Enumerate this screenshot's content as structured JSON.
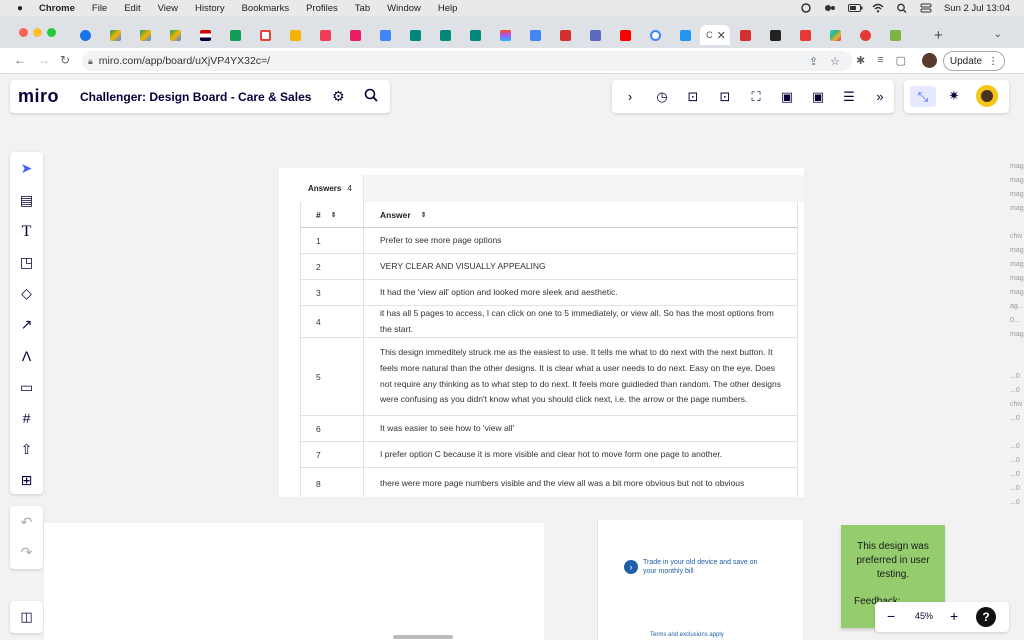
{
  "menubar": {
    "app": "Chrome",
    "items": [
      "File",
      "Edit",
      "View",
      "History",
      "Bookmarks",
      "Profiles",
      "Tab",
      "Window",
      "Help"
    ],
    "datetime": "Sun 2 Jul  13:04"
  },
  "browser": {
    "active_tab_letter": "C",
    "url": "miro.com/app/board/uXjVP4YX32c=/",
    "update_label": "Update"
  },
  "miro": {
    "logo": "miro",
    "board_title": "Challenger: Design Board - Care & Sales",
    "zoom": "45%",
    "help": "?"
  },
  "table": {
    "tab_label": "Answers",
    "tab_count": "4",
    "col_num": "#",
    "col_answer": "Answer",
    "rows": [
      {
        "num": "1",
        "answer": "Prefer to see more page options"
      },
      {
        "num": "2",
        "answer": "VERY CLEAR AND VISUALLY APPEALING"
      },
      {
        "num": "3",
        "answer": "It had the 'view all' option and looked more sleek and aesthetic."
      },
      {
        "num": "4",
        "answer": "it has all 5 pages to access, I can click on one to 5 immediately, or view all. So has the most options from the start."
      },
      {
        "num": "5",
        "answer": "This design immeditely struck me as the easiest to use. It tells me what to do next with the next button. It feels more natural than the other designs. It is clear what a user needs to do next. Easy on the eye. Does not require any thinking as to what step to do next. It feels more guidieded than random. The other designs were confusing as you didn't know what you should click next, i.e. the arrow or the page numbers."
      },
      {
        "num": "6",
        "answer": "It was easier to see how to 'view all'"
      },
      {
        "num": "7",
        "answer": "I prefer option C because it is more visible and clear hot to move form one page to another."
      },
      {
        "num": "8",
        "answer": "there were more page numbers visible and the view all was a bit more obvious but not to obvious"
      }
    ]
  },
  "phone": {
    "trade_text": "Trade in your old device and save on your monthly bill",
    "terms_text": "Terms and exclusions apply"
  },
  "sticky": {
    "text": "This design was preferred in user testing.",
    "footer": "Feedback:"
  },
  "right_strip": [
    "mag",
    "mag",
    "mag",
    "mag",
    "",
    "chiv",
    "mag",
    "mag",
    "mag",
    "mag",
    "ag...",
    "0...",
    "mag",
    "",
    "",
    "...0",
    "...0",
    "chiv",
    "...0",
    "",
    "...0",
    "...0",
    "...0",
    "...0",
    "...0"
  ]
}
